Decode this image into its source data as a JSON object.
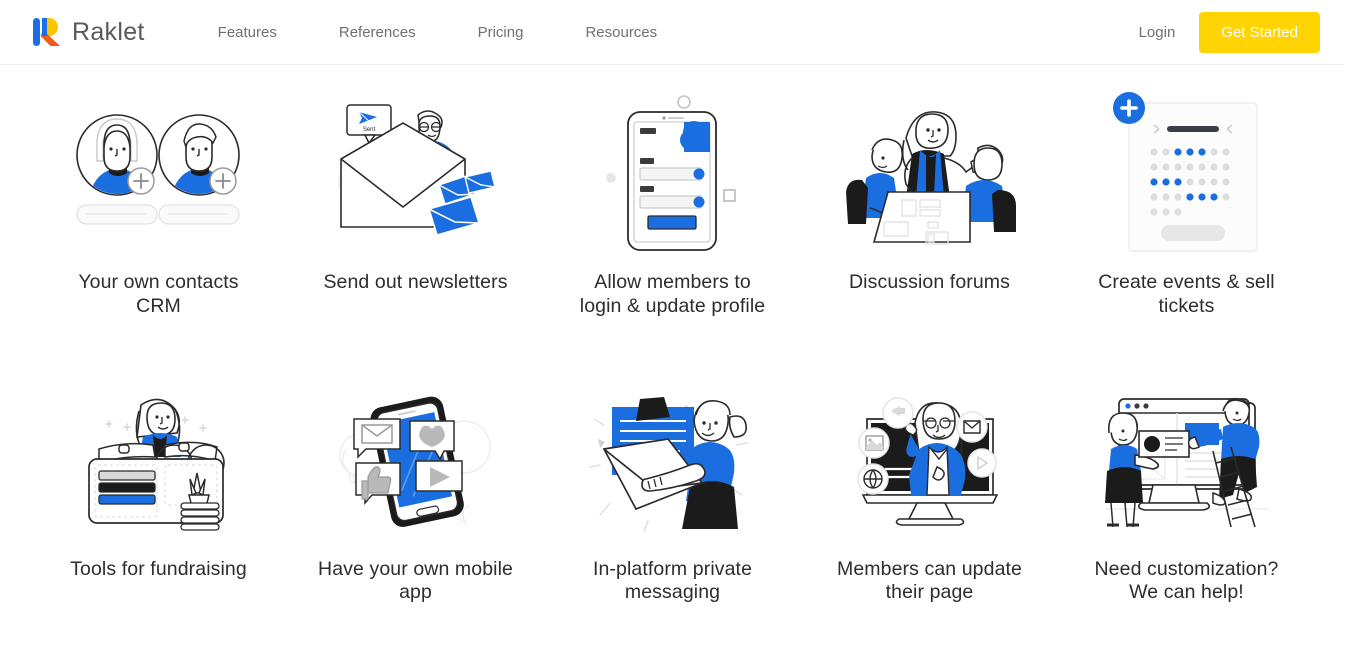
{
  "brand": {
    "name": "Raklet",
    "logo_icon": "raklet-r-logo-icon",
    "colors": {
      "blue": "#1c6ee4",
      "yellow": "#ffc400",
      "orange": "#f25c19"
    }
  },
  "nav": {
    "items": [
      {
        "label": "Features"
      },
      {
        "label": "References"
      },
      {
        "label": "Pricing"
      },
      {
        "label": "Resources"
      }
    ],
    "login_label": "Login",
    "cta_label": "Get Started",
    "cta_color": "#ffd400"
  },
  "features": {
    "accent_blue": "#1a6ee0",
    "items": [
      {
        "caption": "Your own contacts CRM",
        "art": "contacts-crm-illustration"
      },
      {
        "caption": "Send out newsletters",
        "art": "newsletter-illustration"
      },
      {
        "caption": "Allow members to login & update profile",
        "art": "mobile-login-illustration"
      },
      {
        "caption": "Discussion forums",
        "art": "discussion-forums-illustration"
      },
      {
        "caption": "Create events & sell tickets",
        "art": "events-calendar-illustration"
      },
      {
        "caption": "Tools for fundraising",
        "art": "fundraising-wallet-illustration"
      },
      {
        "caption": "Have your own mobile app",
        "art": "mobile-app-illustration"
      },
      {
        "caption": "In-platform private messaging",
        "art": "private-messaging-illustration"
      },
      {
        "caption": "Members can update their page",
        "art": "member-page-illustration"
      },
      {
        "caption": "Need customization? We can help!",
        "art": "customization-illustration"
      }
    ]
  },
  "newsletter_art": {
    "tooltip_label": "Sent"
  }
}
